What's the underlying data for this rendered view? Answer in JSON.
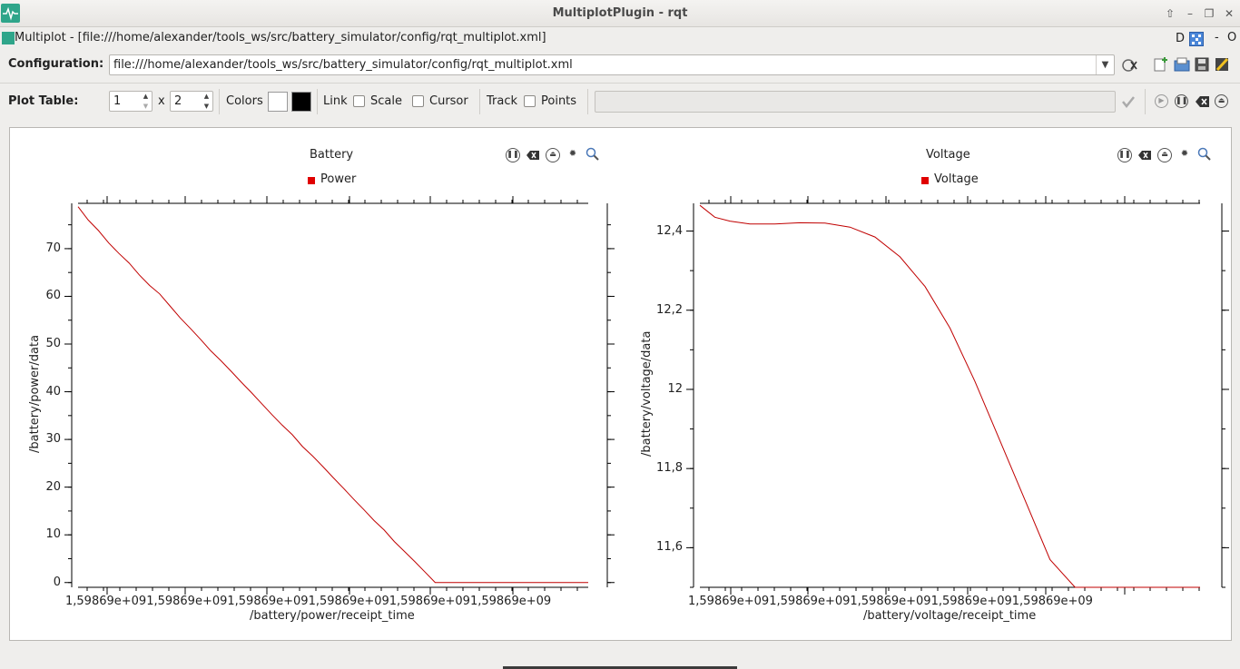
{
  "window": {
    "title": "MultiplotPlugin - rqt",
    "controls": [
      "up-arrow-icon",
      "minimize-icon",
      "restore-icon",
      "close-icon"
    ]
  },
  "plugin": {
    "title": "Multiplot - [file:///home/alexander/tools_ws/src/battery_simulator/config/rqt_multiplot.xml]",
    "help_label": "D",
    "dash": "-",
    "o_label": "O"
  },
  "config": {
    "label": "Configuration:",
    "path": "file:///home/alexander/tools_ws/src/battery_simulator/config/rqt_multiplot.xml"
  },
  "plot_table": {
    "label": "Plot Table:",
    "rows": "1",
    "x": "x",
    "cols": "2",
    "colors_label": "Colors",
    "bg_color": "#ffffff",
    "fg_color": "#000000",
    "link_label": "Link",
    "scale_label": "Scale",
    "cursor_label": "Cursor",
    "track_label": "Track",
    "points_label": "Points"
  },
  "plots": [
    {
      "title": "Battery",
      "legend": "Power",
      "xlabel": "/battery/power/receipt_time",
      "ylabel": "/battery/power/data",
      "xticks": "1,59869e+091,59869e+091,59869e+091,59869e+091,59869e+091,59869e+09",
      "yticks": [
        "0",
        "10",
        "20",
        "30",
        "40",
        "50",
        "60",
        "70"
      ]
    },
    {
      "title": "Voltage",
      "legend": "Voltage",
      "xlabel": "/battery/voltage/receipt_time",
      "ylabel": "/battery/voltage/data",
      "xticks": "1,59869e+091,59869e+091,59869e+091,59869e+091,59869e+09",
      "yticks": [
        "11,6",
        "11,8",
        "12",
        "12,2",
        "12,4"
      ]
    }
  ],
  "chart_data": [
    {
      "type": "line",
      "title": "Battery",
      "xlabel": "/battery/power/receipt_time",
      "ylabel": "/battery/power/data",
      "ylim": [
        -1,
        79.5
      ],
      "series": [
        {
          "name": "Power",
          "color": "#c00000",
          "x": [
            0,
            2,
            4,
            6,
            8,
            10,
            12,
            14,
            16,
            18,
            20,
            22,
            24,
            26,
            28,
            30,
            32,
            34,
            36,
            38,
            40,
            42,
            44,
            46,
            48,
            50,
            52,
            54,
            56,
            58,
            60,
            62,
            64,
            66,
            68,
            70,
            72,
            74,
            76,
            78,
            80,
            82,
            84,
            86,
            88,
            90,
            91,
            93,
            95,
            97,
            100
          ],
          "y": [
            78.8,
            76.0,
            73.8,
            71.2,
            69.0,
            67.0,
            64.5,
            62.3,
            60.5,
            58.0,
            55.5,
            53.3,
            51.0,
            48.6,
            46.5,
            44.3,
            42.0,
            39.8,
            37.5,
            35.2,
            33.0,
            31.0,
            28.5,
            26.5,
            24.3,
            22.0,
            19.8,
            17.5,
            15.3,
            13.0,
            11.0,
            8.6,
            6.5,
            4.4,
            2.2,
            0.0,
            0.0,
            0.0,
            0.0,
            0.0,
            0.0,
            0.0,
            0.0,
            0.0,
            0.0,
            0.0,
            0.0,
            0.0,
            0.0,
            0.0,
            0.0
          ]
        }
      ]
    },
    {
      "type": "line",
      "title": "Voltage",
      "xlabel": "/battery/voltage/receipt_time",
      "ylabel": "/battery/voltage/data",
      "ylim": [
        11.5,
        12.47
      ],
      "series": [
        {
          "name": "Voltage",
          "color": "#c00000",
          "x": [
            0,
            3,
            6,
            10,
            15,
            20,
            25,
            30,
            35,
            40,
            45,
            50,
            55,
            60,
            65,
            70,
            75,
            78,
            80,
            84,
            88,
            100
          ],
          "y": [
            12.465,
            12.435,
            12.425,
            12.418,
            12.418,
            12.421,
            12.42,
            12.41,
            12.385,
            12.335,
            12.26,
            12.155,
            12.02,
            11.87,
            11.72,
            11.57,
            11.5,
            11.5,
            11.5,
            11.5,
            11.5,
            11.5
          ]
        }
      ]
    }
  ]
}
